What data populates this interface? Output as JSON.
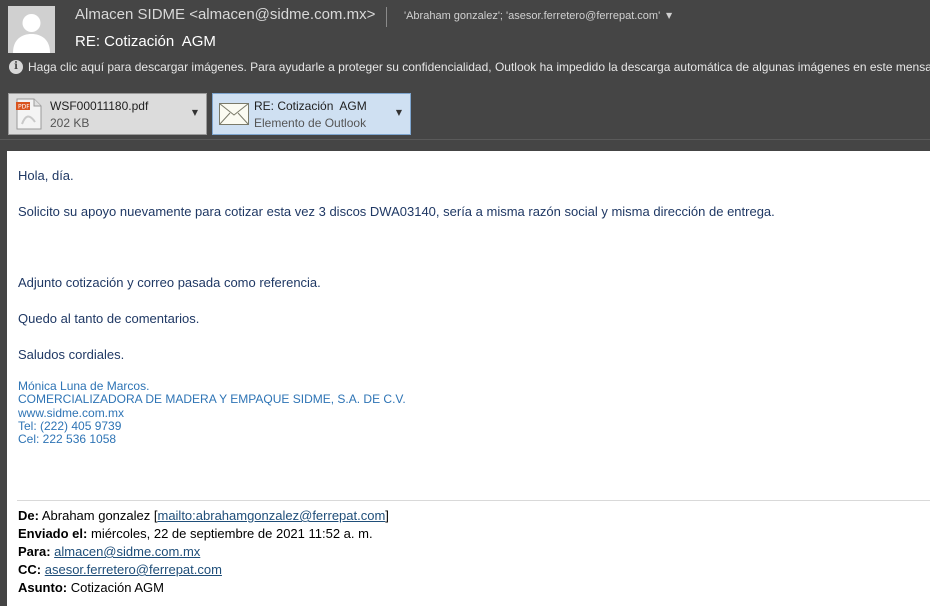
{
  "header": {
    "sender": "Almacen SIDME <almacen@sidme.com.mx>",
    "recipients": "'Abraham gonzalez'; 'asesor.ferretero@ferrepat.com'",
    "subject": "RE: Cotización  AGM",
    "info_bar": "Haga clic aquí para descargar imágenes. Para ayudarle a proteger su confidencialidad, Outlook ha impedido la descarga automática de algunas imágenes en este mensaje."
  },
  "attachments": [
    {
      "name": "WSF00011180.pdf",
      "meta": "202 KB",
      "icon": "pdf-file-icon"
    },
    {
      "name": "RE: Cotización  AGM",
      "meta": "Elemento de Outlook",
      "icon": "envelope-icon"
    }
  ],
  "body": {
    "greeting": "Hola, día.",
    "line1": "Solicito su apoyo nuevamente para cotizar esta vez 3 discos DWA03140, sería a misma razón social y misma dirección de entrega.",
    "line2": "Adjunto cotización y correo pasada como referencia.",
    "line3": "Quedo al tanto de comentarios.",
    "line4": "Saludos cordiales."
  },
  "signature": {
    "name": "Mónica Luna de Marcos.",
    "company": "COMERCIALIZADORA DE MADERA Y EMPAQUE SIDME, S.A. DE C.V.",
    "website": "www.sidme.com.mx",
    "tel": "Tel: (222) 405 9739",
    "cel": "Cel: 222 536 1058"
  },
  "quoted": {
    "from_label": "De:",
    "from_name": "Abraham gonzalez [",
    "from_link": "mailto:abrahamgonzalez@ferrepat.com",
    "from_end": "]",
    "sent_label": "Enviado el:",
    "sent_value": "miércoles, 22 de septiembre de 2021 11:52 a. m.",
    "to_label": "Para:",
    "to_value": "almacen@sidme.com.mx",
    "cc_label": "CC:",
    "cc_value": "asesor.ferretero@ferrepat.com",
    "subject_label": "Asunto:",
    "subject_value": "Cotización AGM"
  }
}
